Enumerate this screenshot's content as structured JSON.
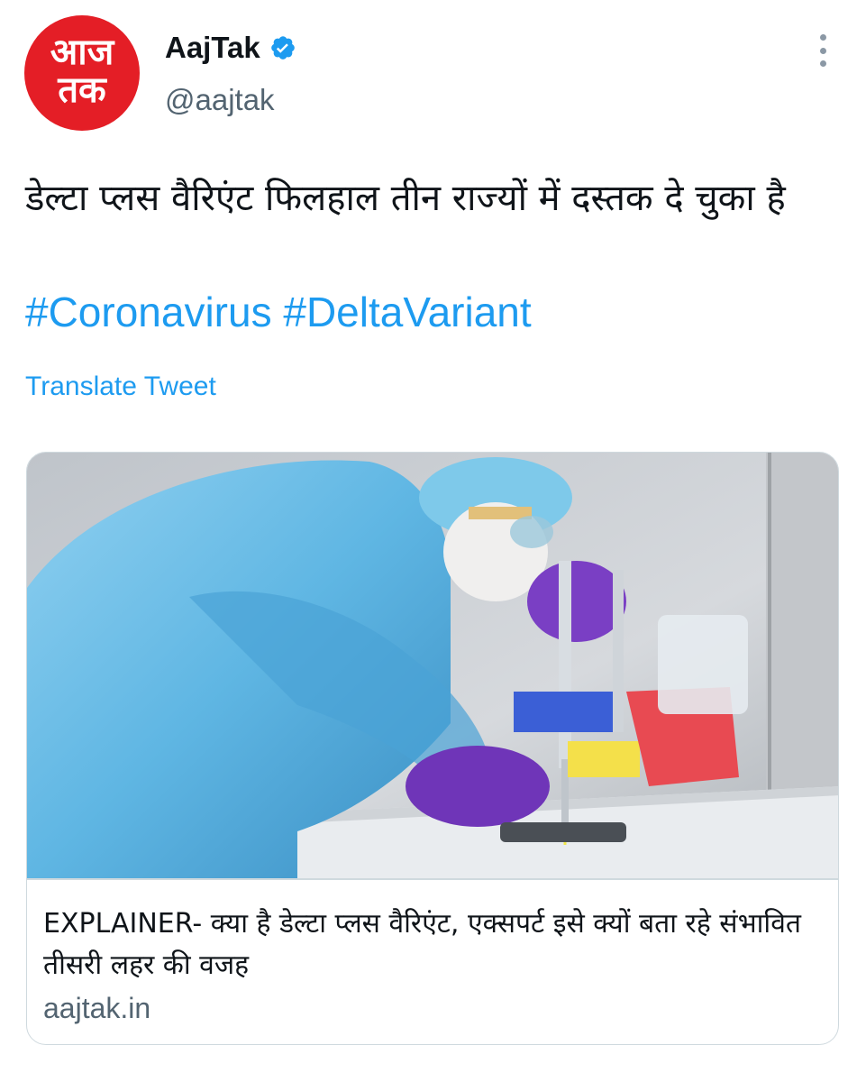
{
  "author": {
    "avatar_text_line1": "आज",
    "avatar_text_line2": "तक",
    "display_name": "AajTak",
    "handle": "@aajtak",
    "verified_icon": "verified-badge-icon",
    "brand_color": "#e41e26"
  },
  "tweet": {
    "text": "डेल्टा प्लस वैरिएंट फिलहाल तीन राज्यों में दस्तक दे चुका है",
    "hashtags": [
      "#Coronavirus",
      "#DeltaVariant"
    ],
    "translate_label": "Translate Tweet",
    "link_color": "#1d9bf0"
  },
  "card": {
    "image_alt": "lab-technician-ppe-pipette-photo",
    "title": "EXPLAINER- क्या है डेल्टा प्लस वैरिएंट, एक्सपर्ट इसे क्यों बता रहे संभावित तीसरी लहर की वजह",
    "domain": "aajtak.in"
  },
  "icons": {
    "more": "more-options-icon"
  }
}
